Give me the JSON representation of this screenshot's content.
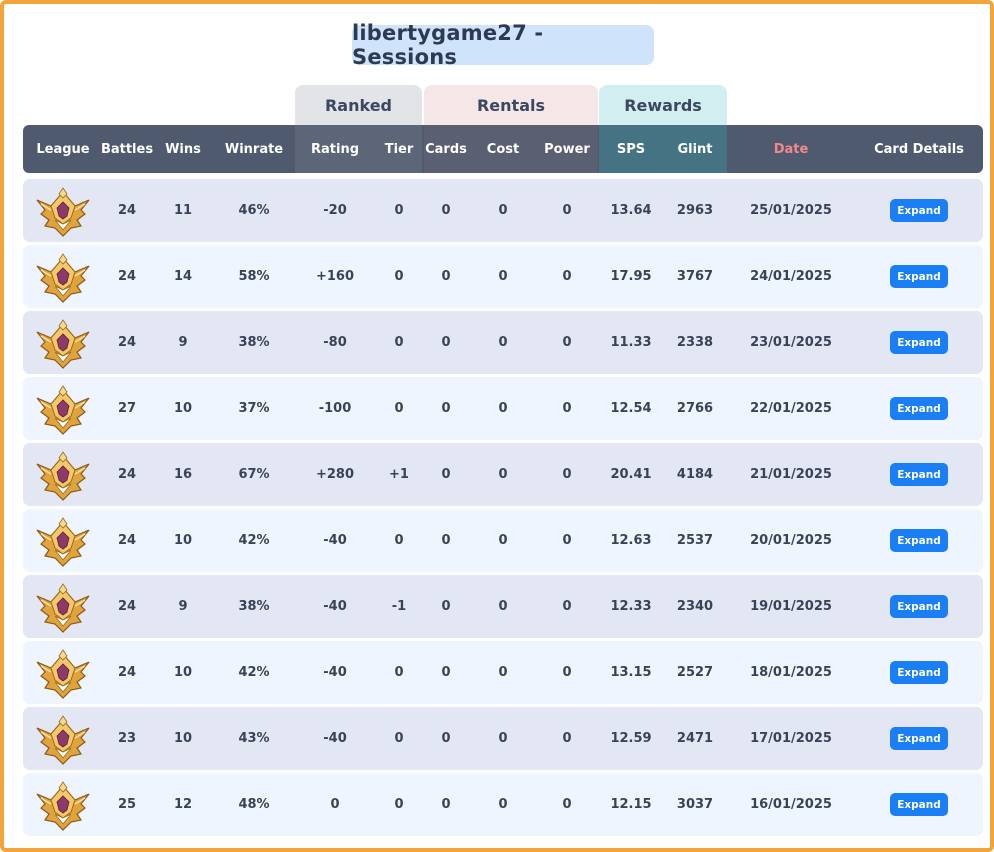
{
  "title": "libertygame27 - Sessions",
  "groups": {
    "ranked": "Ranked",
    "rentals": "Rentals",
    "rewards": "Rewards"
  },
  "columns": {
    "league": "League",
    "battles": "Battles",
    "wins": "Wins",
    "winrate": "Winrate",
    "rating": "Rating",
    "tier": "Tier",
    "cards": "Cards",
    "cost": "Cost",
    "power": "Power",
    "sps": "SPS",
    "glint": "Glint",
    "date": "Date",
    "card_details": "Card Details"
  },
  "expand_label": "Expand",
  "league_icon": "gold-league-badge-icon",
  "rows": [
    {
      "battles": "24",
      "wins": "11",
      "winrate": "46%",
      "rating": "-20",
      "tier": "0",
      "cards": "0",
      "cost": "0",
      "power": "0",
      "sps": "13.64",
      "glint": "2963",
      "date": "25/01/2025"
    },
    {
      "battles": "24",
      "wins": "14",
      "winrate": "58%",
      "rating": "+160",
      "tier": "0",
      "cards": "0",
      "cost": "0",
      "power": "0",
      "sps": "17.95",
      "glint": "3767",
      "date": "24/01/2025"
    },
    {
      "battles": "24",
      "wins": "9",
      "winrate": "38%",
      "rating": "-80",
      "tier": "0",
      "cards": "0",
      "cost": "0",
      "power": "0",
      "sps": "11.33",
      "glint": "2338",
      "date": "23/01/2025"
    },
    {
      "battles": "27",
      "wins": "10",
      "winrate": "37%",
      "rating": "-100",
      "tier": "0",
      "cards": "0",
      "cost": "0",
      "power": "0",
      "sps": "12.54",
      "glint": "2766",
      "date": "22/01/2025"
    },
    {
      "battles": "24",
      "wins": "16",
      "winrate": "67%",
      "rating": "+280",
      "tier": "+1",
      "cards": "0",
      "cost": "0",
      "power": "0",
      "sps": "20.41",
      "glint": "4184",
      "date": "21/01/2025"
    },
    {
      "battles": "24",
      "wins": "10",
      "winrate": "42%",
      "rating": "-40",
      "tier": "0",
      "cards": "0",
      "cost": "0",
      "power": "0",
      "sps": "12.63",
      "glint": "2537",
      "date": "20/01/2025"
    },
    {
      "battles": "24",
      "wins": "9",
      "winrate": "38%",
      "rating": "-40",
      "tier": "-1",
      "cards": "0",
      "cost": "0",
      "power": "0",
      "sps": "12.33",
      "glint": "2340",
      "date": "19/01/2025"
    },
    {
      "battles": "24",
      "wins": "10",
      "winrate": "42%",
      "rating": "-40",
      "tier": "0",
      "cards": "0",
      "cost": "0",
      "power": "0",
      "sps": "13.15",
      "glint": "2527",
      "date": "18/01/2025"
    },
    {
      "battles": "23",
      "wins": "10",
      "winrate": "43%",
      "rating": "-40",
      "tier": "0",
      "cards": "0",
      "cost": "0",
      "power": "0",
      "sps": "12.59",
      "glint": "2471",
      "date": "17/01/2025"
    },
    {
      "battles": "25",
      "wins": "12",
      "winrate": "48%",
      "rating": "0",
      "tier": "0",
      "cards": "0",
      "cost": "0",
      "power": "0",
      "sps": "12.15",
      "glint": "3037",
      "date": "16/01/2025"
    }
  ]
}
